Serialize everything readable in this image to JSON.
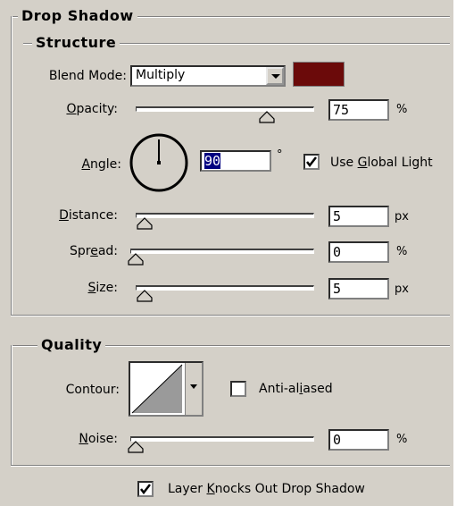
{
  "drop_shadow": {
    "title": "Drop Shadow",
    "structure": {
      "title": "Structure",
      "blend_mode_label": "Blend Mode:",
      "blend_mode_value": "Multiply",
      "shadow_color": "#6b0a0a",
      "opacity_label": "Opacity:",
      "opacity_value": "75",
      "opacity_unit": "%",
      "opacity_fraction": 0.75,
      "angle_label": "Angle:",
      "angle_value": "90",
      "angle_unit": "°",
      "use_global_light_label": "Use Global Light",
      "use_global_light_checked": true,
      "distance_label": "Distance:",
      "distance_value": "5",
      "distance_unit": "px",
      "distance_fraction": 0.02,
      "spread_label": "Spread:",
      "spread_value": "0",
      "spread_unit": "%",
      "spread_fraction": 0.0,
      "size_label": "Size:",
      "size_value": "5",
      "size_unit": "px",
      "size_fraction": 0.02
    },
    "quality": {
      "title": "Quality",
      "contour_label": "Contour:",
      "anti_aliased_label": "Anti-aliased",
      "anti_aliased_checked": false,
      "noise_label": "Noise:",
      "noise_value": "0",
      "noise_unit": "%",
      "noise_fraction": 0.0
    },
    "layer_knocks_out_label": "Layer Knocks Out Drop Shadow",
    "layer_knocks_out_checked": true
  }
}
